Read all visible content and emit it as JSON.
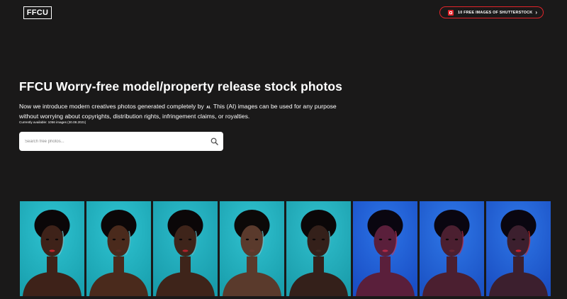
{
  "header": {
    "logo_text": "FFCU",
    "promo_label": "10 FREE IMAGES OF SHUTTERSTOCK",
    "promo_chevron": "›",
    "promo_icon": "shutterstock-icon"
  },
  "hero": {
    "title": "FFCU Worry-free model/property release stock photos",
    "intro_before_ai": "Now we introduce modern creatives photos generated completely by",
    "ai_label": "AI.",
    "intro_after_ai": "This (AI) images can be used for any purpose without worrying about copyrights, distribution rights, infringement claims, or royalties.",
    "count_text": "Currently available: 1056 images (30.08.2021)"
  },
  "search": {
    "placeholder": "Search free photos...",
    "value": "",
    "icon": "search-icon"
  },
  "colors": {
    "background": "#1a1919",
    "accent_red": "#e2242a",
    "teal_backdrop": "#1fa6b4",
    "blue_backdrop": "#1c53c8"
  },
  "gallery": [
    {
      "backdrop": "#1aa2b0",
      "light": "#2fc3d1",
      "skin": "#3e2219",
      "hair": "#0b0708",
      "rim": "#79c9d2",
      "lips": "#c0242c"
    },
    {
      "backdrop": "#1aa2b0",
      "light": "#2fc3d1",
      "skin": "#4a2a1c",
      "hair": "#0b0708",
      "rim": "#6fc3cc",
      "lips": "#5a2a22"
    },
    {
      "backdrop": "#199cab",
      "light": "#2cbccb",
      "skin": "#3e241a",
      "hair": "#0b0708",
      "rim": "#62b9c4",
      "lips": "#b0222c"
    },
    {
      "backdrop": "#1aa0ae",
      "light": "#31c2d0",
      "skin": "#5a3a2c",
      "hair": "#0c0908",
      "rim": "#76c6cf",
      "lips": "#6a3a30"
    },
    {
      "backdrop": "#1b9eac",
      "light": "#30bfcd",
      "skin": "#34201a",
      "hair": "#0b0708",
      "rim": "#5fb7c2",
      "lips": "#3f2822"
    },
    {
      "backdrop": "#1a4fc6",
      "light": "#2c74e6",
      "skin": "#5a1f3b",
      "hair": "#0a0610",
      "rim": "#c43a5a",
      "lips": "#b22a48"
    },
    {
      "backdrop": "#1c54c6",
      "light": "#2f78e8",
      "skin": "#4b1f30",
      "hair": "#0a0610",
      "rim": "#b93050",
      "lips": "#6a2432"
    },
    {
      "backdrop": "#1b50c4",
      "light": "#2e76e6",
      "skin": "#3c1f2e",
      "hair": "#0a0610",
      "rim": "#d0302e",
      "lips": "#c0202c"
    }
  ]
}
